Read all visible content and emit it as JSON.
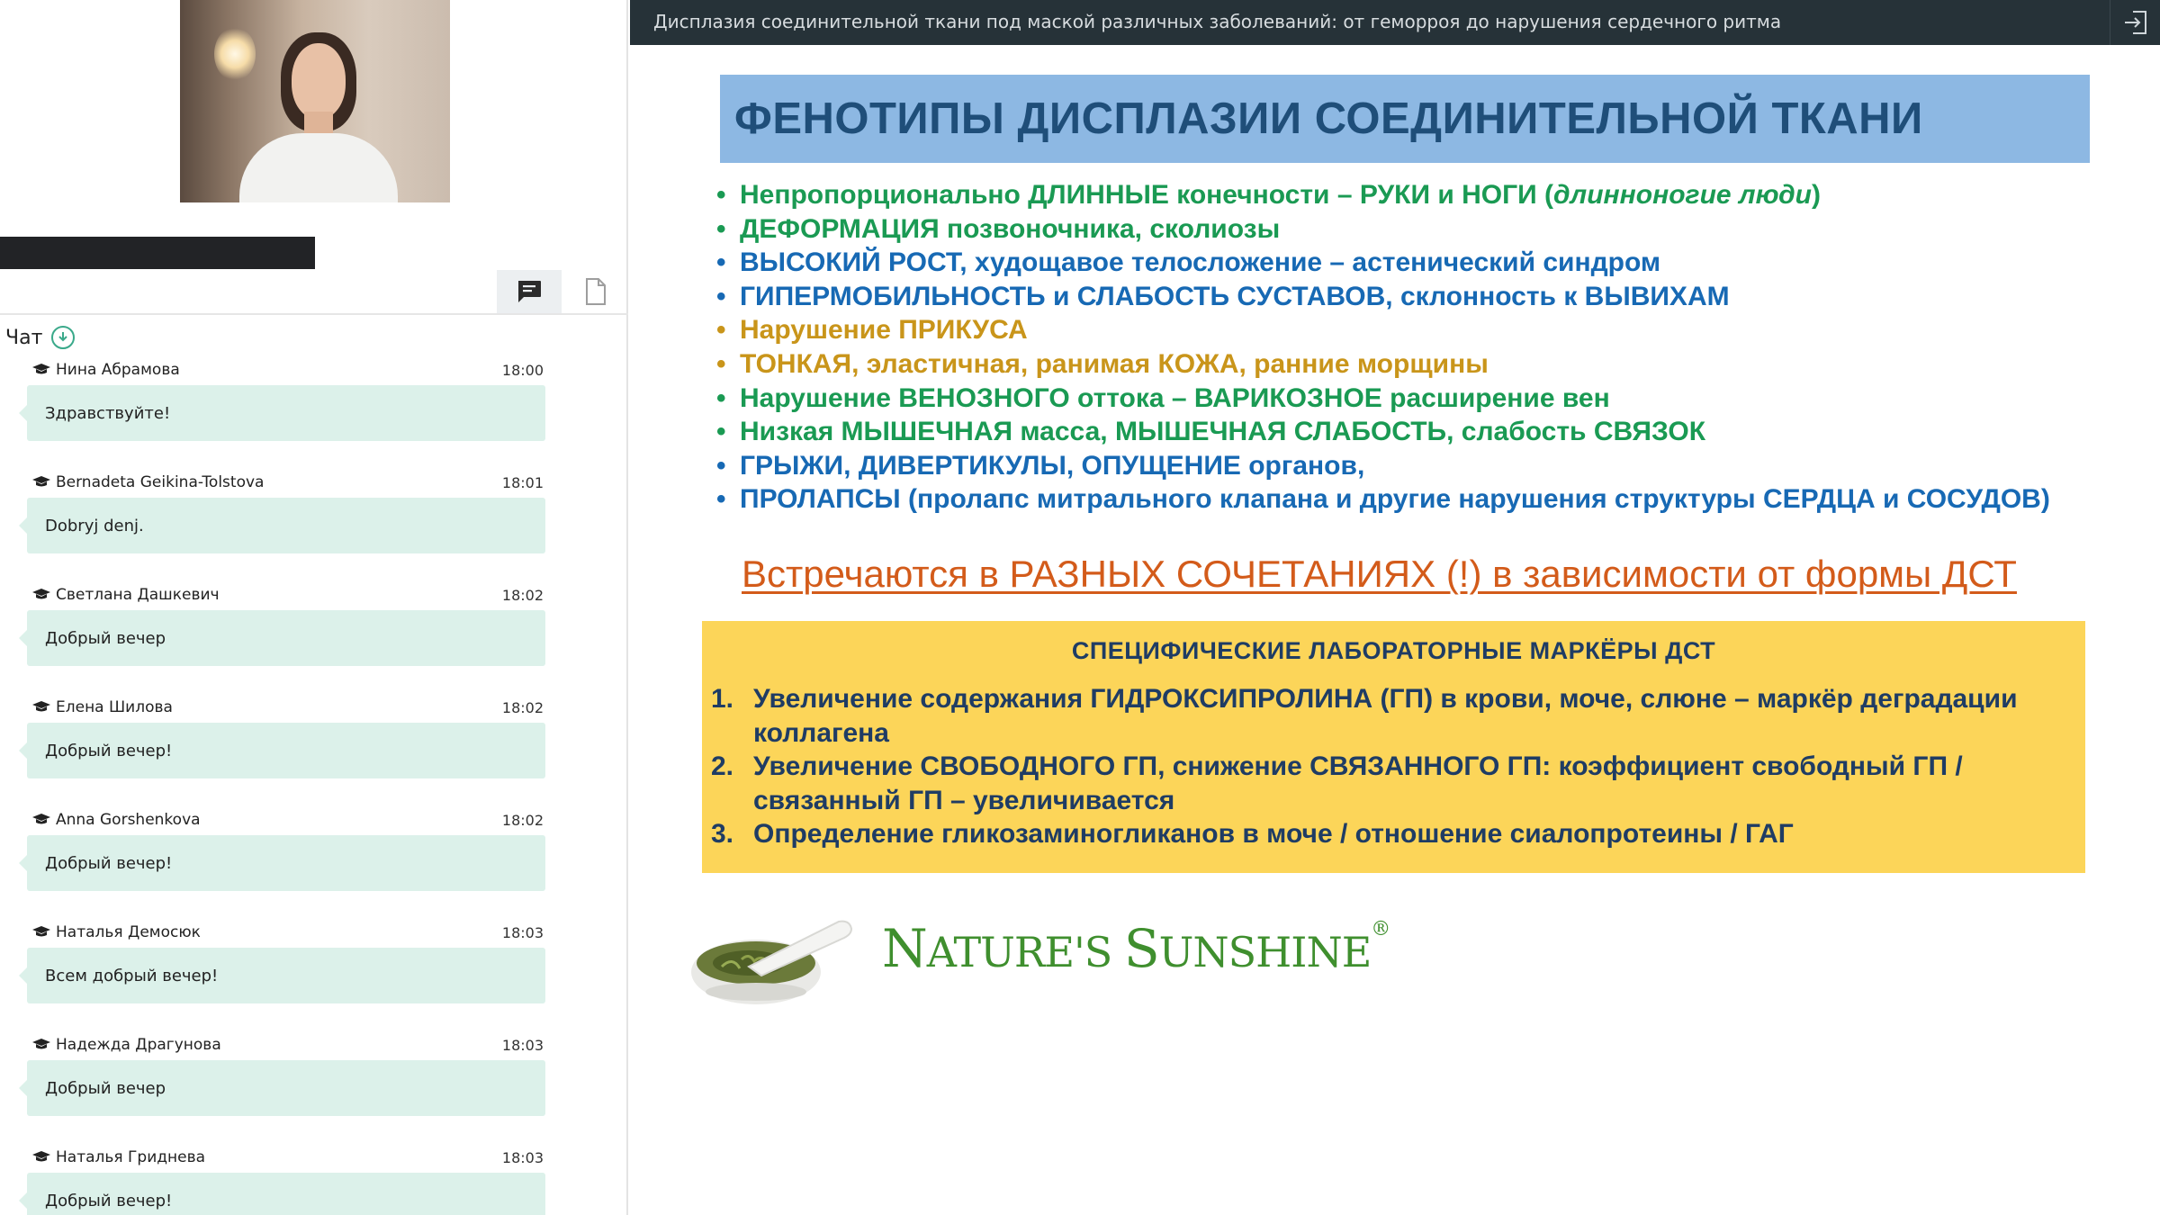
{
  "chat_panel": {
    "title": "Чат",
    "messages": [
      {
        "author": "Нина Абрамова",
        "time": "18:00",
        "text": "Здравствуйте!"
      },
      {
        "author": "Bernadeta Geikina-Tolstova",
        "time": "18:01",
        "text": "Dobryj denj."
      },
      {
        "author": "Светлана Дашкевич",
        "time": "18:02",
        "text": "Добрый вечер"
      },
      {
        "author": "Елена Шилова",
        "time": "18:02",
        "text": "Добрый вечер!"
      },
      {
        "author": "Anna Gorshenkova",
        "time": "18:02",
        "text": "Добрый вечер!"
      },
      {
        "author": "Наталья Демосюк",
        "time": "18:03",
        "text": "Всем добрый вечер!"
      },
      {
        "author": "Надежда Драгунова",
        "time": "18:03",
        "text": "Добрый вечер"
      },
      {
        "author": "Наталья Гриднева",
        "time": "18:03",
        "text": "Добрый вечер!"
      }
    ]
  },
  "header": {
    "title": "Дисплазия соединительной ткани под маской различных заболеваний: от геморроя до нарушения сердечного ритма"
  },
  "slide": {
    "title": "ФЕНОТИПЫ  ДИСПЛАЗИИ СОЕДИНИТЕЛЬНОЙ ТКАНИ",
    "bullets": [
      {
        "text": "Непропорционально ДЛИННЫЕ конечности – РУКИ и НОГИ (",
        "emph": "длинноногие  люди",
        "tail": ")",
        "color": "#1a9a53"
      },
      {
        "text": "ДЕФОРМАЦИЯ позвоночника, сколиозы",
        "color": "#1a9a53"
      },
      {
        "text": "ВЫСОКИЙ РОСТ, худощавое телосложение – астенический синдром",
        "color": "#1769b4"
      },
      {
        "text": "ГИПЕРМОБИЛЬНОСТЬ и СЛАБОСТЬ СУСТАВОВ, склонность к ВЫВИХАМ",
        "color": "#1769b4"
      },
      {
        "text": "Нарушение ПРИКУСА",
        "color": "#c9951a"
      },
      {
        "text": "ТОНКАЯ, эластичная, ранимая КОЖА, ранние морщины",
        "color": "#c9951a"
      },
      {
        "text": "Нарушение ВЕНОЗНОГО оттока – ВАРИКОЗНОЕ расширение вен",
        "color": "#1a9a53"
      },
      {
        "text": "Низкая МЫШЕЧНАЯ масса, МЫШЕЧНАЯ  СЛАБОСТЬ, слабость СВЯЗОК",
        "color": "#1a9a53"
      },
      {
        "text": "ГРЫЖИ, ДИВЕРТИКУЛЫ, ОПУЩЕНИЕ органов,",
        "color": "#1769b4"
      },
      {
        "text": "ПРОЛАПСЫ (пролапс митрального клапана и другие нарушения структуры СЕРДЦА и СОСУДОВ)",
        "color": "#1769b4"
      }
    ],
    "note": "Встречаются в РАЗНЫХ  СОЧЕТАНИЯХ (!) в зависимости от формы ДСТ",
    "markers_title": "СПЕЦИФИЧЕСКИЕ  ЛАБОРАТОРНЫЕ  МАРКЁРЫ  ДСТ",
    "markers": [
      {
        "num": "1.",
        "text": "Увеличение содержания ГИДРОКСИПРОЛИНА (ГП) в крови, моче, слюне – маркёр деградации коллагена"
      },
      {
        "num": "2.",
        "text": "Увеличение СВОБОДНОГО ГП, снижение СВЯЗАННОГО ГП: коэффициент свободный ГП / связанный ГП – увеличивается"
      },
      {
        "num": "3.",
        "text": "Определение гликозаминогликанов в моче / отношение сиалопротеины / ГАГ"
      }
    ],
    "brand": {
      "part1": "N",
      "part2": "ATURE'S ",
      "part3": "S",
      "part4": "UNSHINE",
      "mark": "®"
    }
  },
  "colors": {
    "title_bar": "#263238",
    "chat_bubble": "#dcf1ea",
    "accent_green": "#3aa98a",
    "slide_title_bg": "#8db8e3",
    "markers_bg": "#fcd559",
    "note": "#d35b1a"
  },
  "icons": {
    "chat_tab": "chat-bubble-icon",
    "files_tab": "document-icon",
    "download": "download-circle-icon",
    "exit": "exit-icon",
    "author": "graduation-cap-icon"
  }
}
